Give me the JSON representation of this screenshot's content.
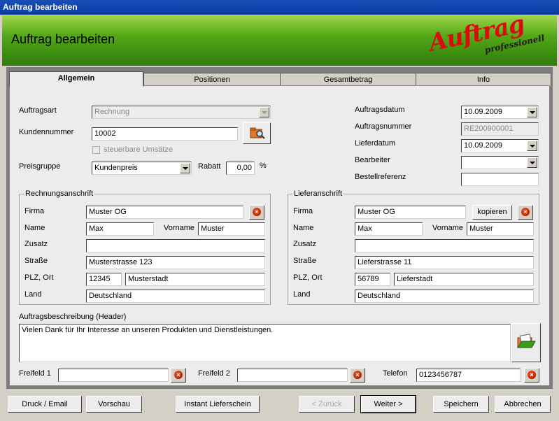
{
  "window": {
    "title": "Auftrag bearbeiten"
  },
  "header": {
    "title": "Auftrag bearbeiten",
    "logo_main": "Auftrag",
    "logo_sub": "professionell"
  },
  "tabs": [
    {
      "label": "Allgemein",
      "active": true
    },
    {
      "label": "Positionen",
      "active": false
    },
    {
      "label": "Gesamtbetrag",
      "active": false
    },
    {
      "label": "Info",
      "active": false
    }
  ],
  "left_form": {
    "auftragsart_label": "Auftragsart",
    "auftragsart_value": "Rechnung",
    "kundennummer_label": "Kundennummer",
    "kundennummer_value": "10002",
    "steuerbare_label": "steuerbare Umsätze",
    "preisgruppe_label": "Preisgruppe",
    "preisgruppe_value": "Kundenpreis",
    "rabatt_label": "Rabatt",
    "rabatt_value": "0,00",
    "rabatt_unit": "%"
  },
  "right_form": {
    "auftragsdatum_label": "Auftragsdatum",
    "auftragsdatum_value": "10.09.2009",
    "auftragsnummer_label": "Auftragsnummer",
    "auftragsnummer_value": "RE200900001",
    "lieferdatum_label": "Lieferdatum",
    "lieferdatum_value": "10.09.2009",
    "bearbeiter_label": "Bearbeiter",
    "bearbeiter_value": "",
    "bestellreferenz_label": "Bestellreferenz",
    "bestellreferenz_value": ""
  },
  "rechnung": {
    "title": "Rechnungsanschrift",
    "firma_label": "Firma",
    "firma": "Muster OG",
    "name_label": "Name",
    "name": "Max",
    "vorname_label": "Vorname",
    "vorname": "Muster",
    "zusatz_label": "Zusatz",
    "zusatz": "",
    "strasse_label": "Straße",
    "strasse": "Musterstrasse 123",
    "plzort_label": "PLZ, Ort",
    "plz": "12345",
    "ort": "Musterstadt",
    "land_label": "Land",
    "land": "Deutschland"
  },
  "liefer": {
    "title": "Lieferanschrift",
    "firma_label": "Firma",
    "firma": "Muster OG",
    "kopieren": "kopieren",
    "name_label": "Name",
    "name": "Max",
    "vorname_label": "Vorname",
    "vorname": "Muster",
    "zusatz_label": "Zusatz",
    "zusatz": "",
    "strasse_label": "Straße",
    "strasse": "Lieferstrasse 11",
    "plzort_label": "PLZ, Ort",
    "plz": "56789",
    "ort": "Lieferstadt",
    "land_label": "Land",
    "land": "Deutschland"
  },
  "beschreibung": {
    "label": "Auftragsbeschreibung (Header)",
    "text": "Vielen Dank für Ihr Interesse an unseren Produkten und Dienstleistungen."
  },
  "bottom_fields": {
    "freifeld1_label": "Freifeld 1",
    "freifeld1": "",
    "freifeld2_label": "Freifeld 2",
    "freifeld2": "",
    "telefon_label": "Telefon",
    "telefon": "0123456787"
  },
  "buttons": {
    "druck": "Druck / Email",
    "vorschau": "Vorschau",
    "instant": "Instant Lieferschein",
    "zurueck": "< Zurück",
    "weiter": "Weiter >",
    "speichern": "Speichern",
    "abbrechen": "Abbrechen"
  },
  "icons": {
    "close": "×"
  },
  "colors": {
    "titlebar": "#0b3aa4",
    "banner": "#55a818",
    "logo": "#d60e0e"
  }
}
